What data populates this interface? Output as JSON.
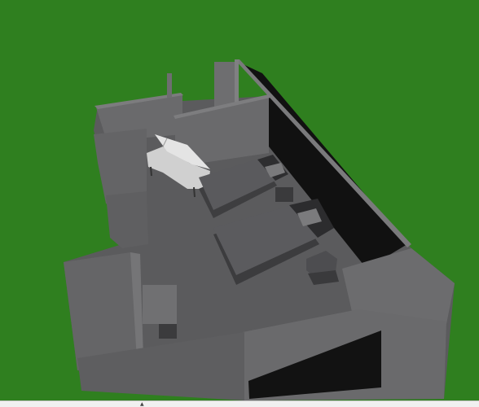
{
  "scene": {
    "background_color": "#2f7f1f",
    "wall_color": "#6a6a6c",
    "wall_dark": "#141414",
    "floor_color": "#5b5b5d",
    "furniture_color": "#4a4a4d",
    "piano_color": "#c8c8c8"
  },
  "status": {
    "text": "",
    "icon": "cursor-icon"
  }
}
